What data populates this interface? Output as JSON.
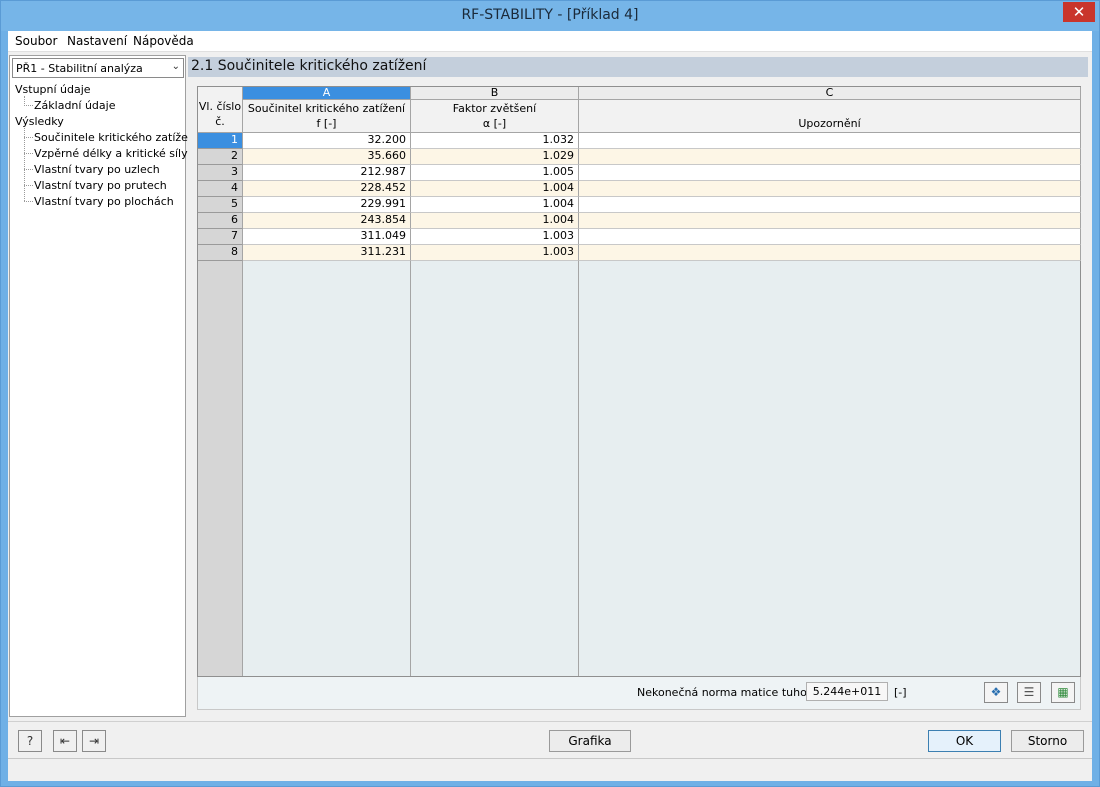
{
  "window": {
    "title": "RF-STABILITY - [Příklad 4]",
    "close_symbol": "✕"
  },
  "menu": {
    "items": [
      "Soubor",
      "Nastavení",
      "Nápověda"
    ]
  },
  "sidebar": {
    "combo_value": "PŘ1 - Stabilitní analýza",
    "tree": {
      "input_group": "Vstupní údaje",
      "input_items": [
        "Základní údaje"
      ],
      "results_group": "Výsledky",
      "results_items": [
        "Součinitele kritického zatížení",
        "Vzpěrné délky a kritické síly",
        "Vlastní tvary po uzlech",
        "Vlastní tvary po prutech",
        "Vlastní tvary po plochách"
      ]
    }
  },
  "section": {
    "title": "2.1 Součinitele kritického zatížení"
  },
  "table": {
    "col_letters": [
      "A",
      "B",
      "C"
    ],
    "rownum_header": [
      "Vl. číslo",
      "č."
    ],
    "col_a_header": [
      "Součinitel kritického zatížení",
      "f [-]"
    ],
    "col_b_header": [
      "Faktor zvětšení",
      "α [-]"
    ],
    "col_c_header": "Upozornění",
    "rows": [
      {
        "n": "1",
        "f": "32.200",
        "alpha": "1.032",
        "note": ""
      },
      {
        "n": "2",
        "f": "35.660",
        "alpha": "1.029",
        "note": ""
      },
      {
        "n": "3",
        "f": "212.987",
        "alpha": "1.005",
        "note": ""
      },
      {
        "n": "4",
        "f": "228.452",
        "alpha": "1.004",
        "note": ""
      },
      {
        "n": "5",
        "f": "229.991",
        "alpha": "1.004",
        "note": ""
      },
      {
        "n": "6",
        "f": "243.854",
        "alpha": "1.004",
        "note": ""
      },
      {
        "n": "7",
        "f": "311.049",
        "alpha": "1.003",
        "note": ""
      },
      {
        "n": "8",
        "f": "311.231",
        "alpha": "1.003",
        "note": ""
      }
    ]
  },
  "footer": {
    "norm_label": "Nekonečná norma matice tuhosti:",
    "norm_value": "5.244e+011",
    "norm_unit": "[-]"
  },
  "buttons": {
    "grafika": "Grafika",
    "ok": "OK",
    "cancel": "Storno"
  },
  "colors": {
    "accent": "#3b8fe0",
    "title_bar": "#76b5e8",
    "close": "#c9352c"
  }
}
